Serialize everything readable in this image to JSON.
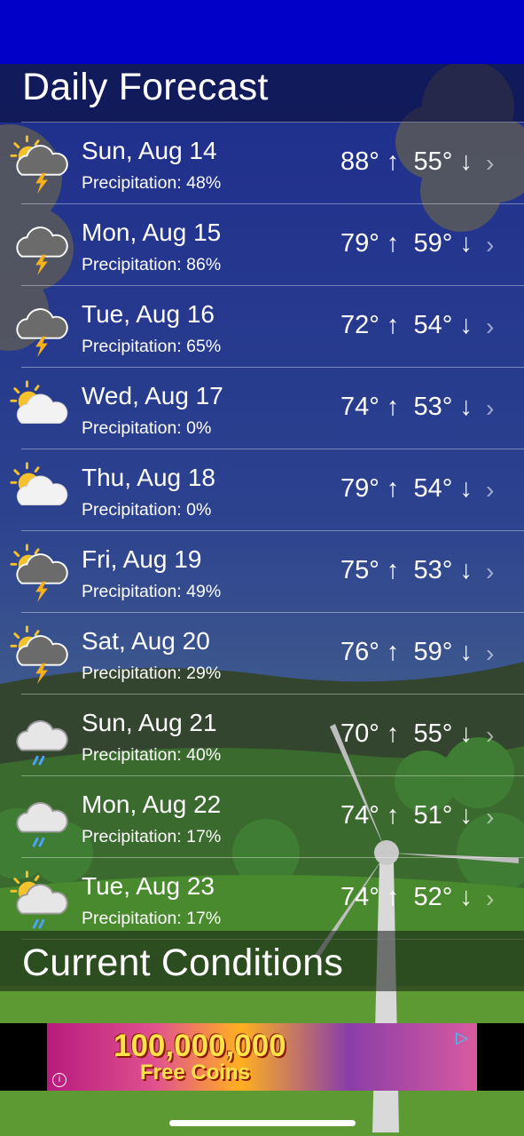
{
  "status_bar": {
    "color": "#0000c8"
  },
  "daily_header": {
    "title": "Daily Forecast"
  },
  "forecast": [
    {
      "day": "Sun, Aug 14",
      "precip": "Precipitation: 48%",
      "high": "88°",
      "low": "55°",
      "icon": "sun-cloud-lightning-icon"
    },
    {
      "day": "Mon, Aug 15",
      "precip": "Precipitation: 86%",
      "high": "79°",
      "low": "59°",
      "icon": "cloud-lightning-icon"
    },
    {
      "day": "Tue, Aug 16",
      "precip": "Precipitation: 65%",
      "high": "72°",
      "low": "54°",
      "icon": "cloud-lightning-icon"
    },
    {
      "day": "Wed, Aug 17",
      "precip": "Precipitation: 0%",
      "high": "74°",
      "low": "53°",
      "icon": "partly-cloudy-icon"
    },
    {
      "day": "Thu, Aug 18",
      "precip": "Precipitation: 0%",
      "high": "79°",
      "low": "54°",
      "icon": "partly-cloudy-icon"
    },
    {
      "day": "Fri, Aug 19",
      "precip": "Precipitation: 49%",
      "high": "75°",
      "low": "53°",
      "icon": "sun-cloud-lightning-icon"
    },
    {
      "day": "Sat, Aug 20",
      "precip": "Precipitation: 29%",
      "high": "76°",
      "low": "59°",
      "icon": "sun-cloud-lightning-icon"
    },
    {
      "day": "Sun, Aug 21",
      "precip": "Precipitation: 40%",
      "high": "70°",
      "low": "55°",
      "icon": "cloud-rain-icon"
    },
    {
      "day": "Mon, Aug 22",
      "precip": "Precipitation: 17%",
      "high": "74°",
      "low": "51°",
      "icon": "cloud-rain-icon"
    },
    {
      "day": "Tue, Aug 23",
      "precip": "Precipitation: 17%",
      "high": "74°",
      "low": "52°",
      "icon": "sun-cloud-rain-icon"
    }
  ],
  "arrows": {
    "up": "↑",
    "down": "↓",
    "chevron": "›"
  },
  "current_header": {
    "title": "Current Conditions"
  },
  "ad": {
    "headline": "100,000,000",
    "subline": "Free Coins",
    "info": "i",
    "play": "▷"
  }
}
